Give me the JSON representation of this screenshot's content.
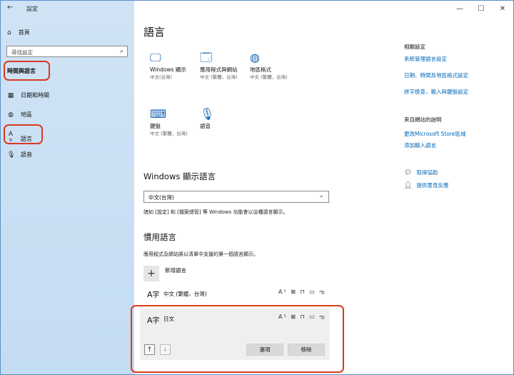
{
  "window": {
    "title": "設定"
  },
  "titlebar": {
    "minimize": "—",
    "maximize": "☐",
    "close": "✕",
    "back": "←"
  },
  "sidebar": {
    "home": "首頁",
    "search_placeholder": "尋找設定",
    "section": "時間與語言",
    "items": [
      {
        "label": "日期和時間",
        "icon": "calendar-icon"
      },
      {
        "label": "地區",
        "icon": "globe-icon"
      },
      {
        "label": "語言",
        "icon": "language-icon"
      },
      {
        "label": "語音",
        "icon": "microphone-icon"
      }
    ]
  },
  "main": {
    "title": "語言",
    "tiles": [
      {
        "name": "Windows 顯示",
        "sub": "中文(台灣)",
        "icon": "monitor-icon"
      },
      {
        "name": "應用程式與網站",
        "sub": "中文 (繁體，台灣)",
        "icon": "app-window-icon"
      },
      {
        "name": "地區格式",
        "sub": "中文 (繁體，台灣)",
        "icon": "globe-icon"
      },
      {
        "name": "鍵盤",
        "sub": "中文 (繁體，台灣)",
        "icon": "keyboard-icon"
      },
      {
        "name": "語音",
        "sub": "",
        "icon": "microphone-icon"
      }
    ],
    "display_language": {
      "title": "Windows 顯示語言",
      "value": "中文(台灣)",
      "note": "諸如 [設定] 和 [檔案總管] 等 Windows 功能會以這種語言顯示。"
    },
    "preferred": {
      "title": "慣用語言",
      "note": "應用程式及網站將以清單中支援的第一個語言顯示。",
      "add_label": "新增語言",
      "languages": [
        {
          "glyph": "字",
          "name": "中文 (繁體，台灣)",
          "features": "A⁵ ⊠ ⊓ ▭ ఌ"
        },
        {
          "glyph": "字",
          "name": "日文",
          "features": "A⁵ ⊠ ⊓ ▭ ఌ"
        }
      ],
      "options_label": "選項",
      "remove_label": "移除"
    }
  },
  "right": {
    "related_title": "相關設定",
    "related_links": [
      "系統管理語言設定",
      "日期、時間及地區格式設定",
      "拼字檢查，輸入與鍵盤設定"
    ],
    "web_title": "來自網站的說明",
    "web_links": [
      "更改Microsoft Store區域",
      "添加輸入語言"
    ],
    "help": [
      {
        "label": "取得協助",
        "icon": "chat-help-icon"
      },
      {
        "label": "提供意見反應",
        "icon": "feedback-icon"
      }
    ]
  },
  "colors": {
    "accent": "#0067b8",
    "sidebar": "#cfe3f5",
    "highlight": "#d83b1f"
  }
}
